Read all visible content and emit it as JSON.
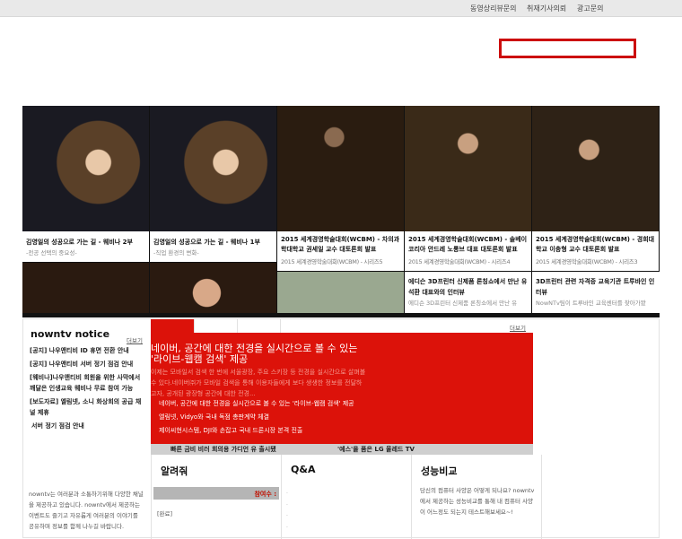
{
  "topnav": [
    "동영상리뷰문의",
    "취재기사의뢰",
    "광고문의"
  ],
  "search": {
    "value": ""
  },
  "videos": [
    {
      "title": "김영일의 성공으로 가는 길 - 웨비나 2부",
      "sub": "-전공 선택의 중요성-",
      "photo": "#6a4d2c"
    },
    {
      "title": "김영일의 성공으로 가는 길 - 웨비나 1부",
      "sub": "-직업 환경의 변화-",
      "photo": "#6a4d2c"
    },
    {
      "title": "2015 세계경영학술대회(WCBM) - 차의과학대학교 권세일 교수 대토론회 발표",
      "sub": "2015 세계경영학술대회(WCBM) - 시리즈5",
      "photo": "#2a1c10"
    },
    {
      "title": "2015 세계경영학술대회(WCBM) - 솔베이코리아 안드레 노롱브 대표 대토론회 발표",
      "sub": "2015 세계경영학술대회(WCBM) - 시리즈4",
      "photo": "#3a2a18"
    },
    {
      "title": "2015 세계경영학술대회(WCBM) - 경희대학교 이충형 교수 대토론회 발표",
      "sub": "2015 세계경영학술대회(WCBM) - 시리즈3",
      "photo": "#2e2216"
    }
  ],
  "videos2": [
    {
      "title": "에디슨 3D프린터 신제품 론칭쇼에서 만난 유석환 대표와의 인터뷰",
      "sub": "에디슨 3D프린터 신제품 론칭쇼에서 만난 유"
    },
    {
      "title": "3D프린터 관련 자격증 교육기관 트루바인 인터뷰",
      "sub": "NowNTv팀이 트루바인 교육센터를 찾아가봤"
    }
  ],
  "notice": {
    "title": "nowntv notice",
    "more": "더보기",
    "items": [
      "[공지] 나우앤티비 ID 휴면 전환 안내",
      "[공지] 나우앤티비 서버 정기 점검 안내",
      "[웨비나]나우앤티비 회원을 위한 사막에서 깨달은 인생교육 웨비나 무료 참여 가능",
      "[보도자료] 엘림넷, 소니 화상회의 공급 채널 제휴",
      "서버 정기 점검 안내"
    ]
  },
  "news": {
    "more": "더보기",
    "headline": "네이버, 공간에 대한 전경을 실시간으로 볼 수 있는 '라이브-웹캠 검색' 제공",
    "summary": "이제는 모바일서 검색 한 번에 서울광장, 주요 스키장 등 전경을 실시간으로 살펴볼 수 있다.네이버㈜가 모바일 검색을 통해 이용자들에게 보다 생생한 정보를 전달하고자, 공개된 광장형 공간에 대한 전경...",
    "links": [
      "네이버, 공간에 대한 전경을 실시간으로 볼 수 있는 '라이브-웹캠 검색' 제공",
      "엘림넷, Vidyo와 국내 독점 총판계약 체결",
      "제이씨현시스템, DJI와 손잡고 국내 드론시장 본격 진출"
    ],
    "strip": [
      "빠른 금비 비러 회의용 가디언 유 출시됐",
      "'예스'을 품은 LG 올레드 TV"
    ]
  },
  "about": "nowntv는 여러분과 소통하기위해 다양한 채널을 제공하고 있습니다. nowntv에서 제공하는 이벤트도 즐기고 자유롭게 여러분의 이야기를 공유하며 정보를 함께 나누길 바랍니다.",
  "tell": {
    "title": "알려줘",
    "count_label": "참여수 :",
    "status": "[완료]"
  },
  "qa": {
    "title": "Q&A",
    "items": [
      "·",
      "·",
      "·",
      "·"
    ]
  },
  "perf": {
    "title": "성능비교",
    "text": "당신의 컴퓨터 사양은 어떻게 되나요? nowntv에서 제공하는 성능비교를 통해 내 컴퓨터 사양이 어느정도 되는지 테스트해보세요~!"
  },
  "colors": {
    "accent": "#dc120a",
    "search_border": "#cc0d0d"
  }
}
